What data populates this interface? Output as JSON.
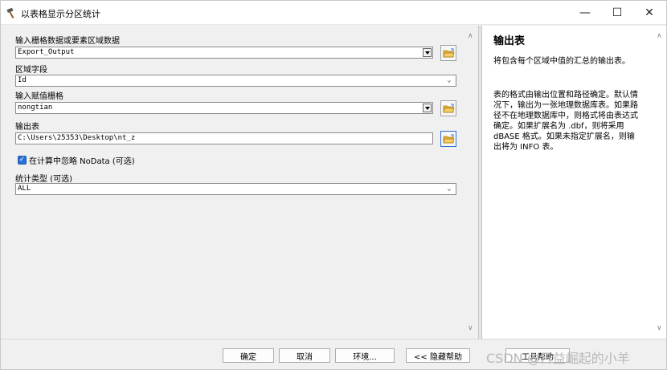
{
  "window": {
    "title": "以表格显示分区统计",
    "minimize_glyph": "—",
    "maximize_glyph": "☐",
    "close_glyph": "✕"
  },
  "form": {
    "input_raster": {
      "label": "输入栅格数据或要素区域数据",
      "value": "Export_Output"
    },
    "zone_field": {
      "label": "区域字段",
      "value": "Id"
    },
    "value_raster": {
      "label": "输入赋值栅格",
      "value": "nongtian"
    },
    "output_table": {
      "label": "输出表",
      "value": "C:\\Users\\25353\\Desktop\\nt_z"
    },
    "ignore_nodata": {
      "label": "在计算中忽略 NoData (可选)",
      "checked": true,
      "check_glyph": "✓"
    },
    "statistics_type": {
      "label": "统计类型 (可选)",
      "value": "ALL"
    },
    "chevron_glyph": "⌄",
    "scroll_up_glyph": "∧",
    "scroll_down_glyph": "∨"
  },
  "help": {
    "title": "输出表",
    "paragraphs": [
      "将包含每个区域中值的汇总的输出表。",
      "表的格式由输出位置和路径确定。默认情况下，输出为一张地理数据库表。如果路径不在地理数据库中，则格式将由表达式确定。如果扩展名为 .dbf，则将采用 dBASE 格式。如果未指定扩展名，则输出将为 INFO 表。"
    ]
  },
  "buttons": {
    "ok": "确定",
    "cancel": "取消",
    "environments": "环境...",
    "hide_help": "<< 隐藏帮助",
    "tool_help": "工具帮助"
  },
  "watermark": "CSDN @日益崛起的小羊",
  "colors": {
    "accent": "#2a6fd6",
    "folder": "#e8b43a"
  }
}
